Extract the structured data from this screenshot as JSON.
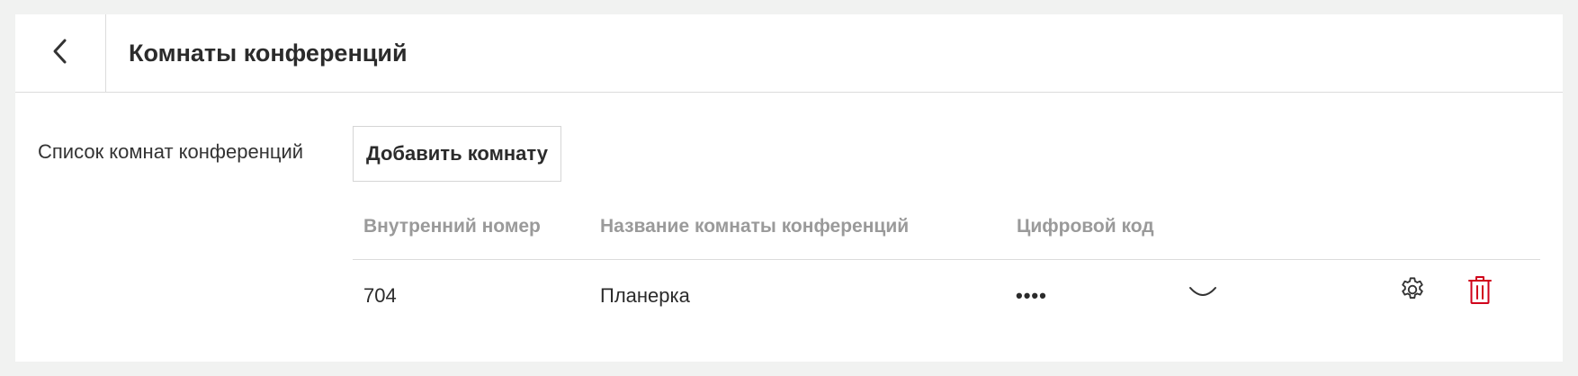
{
  "header": {
    "back_icon": "chevron-left-icon",
    "title": "Комнаты конференций"
  },
  "section": {
    "label": "Список комнат конференций",
    "add_button_label": "Добавить комнату"
  },
  "table": {
    "columns": [
      "Внутренний номер",
      "Название комнаты конференций",
      "Цифровой код"
    ],
    "rows": [
      {
        "number": "704",
        "name": "Планерка",
        "code": "••••",
        "reveal_icon": "eye-closed-icon",
        "settings_icon": "gear-icon",
        "delete_icon": "trash-icon"
      }
    ]
  },
  "colors": {
    "delete": "#d0021b",
    "header_text": "#9a9a9a",
    "background": "#f1f2f1"
  }
}
